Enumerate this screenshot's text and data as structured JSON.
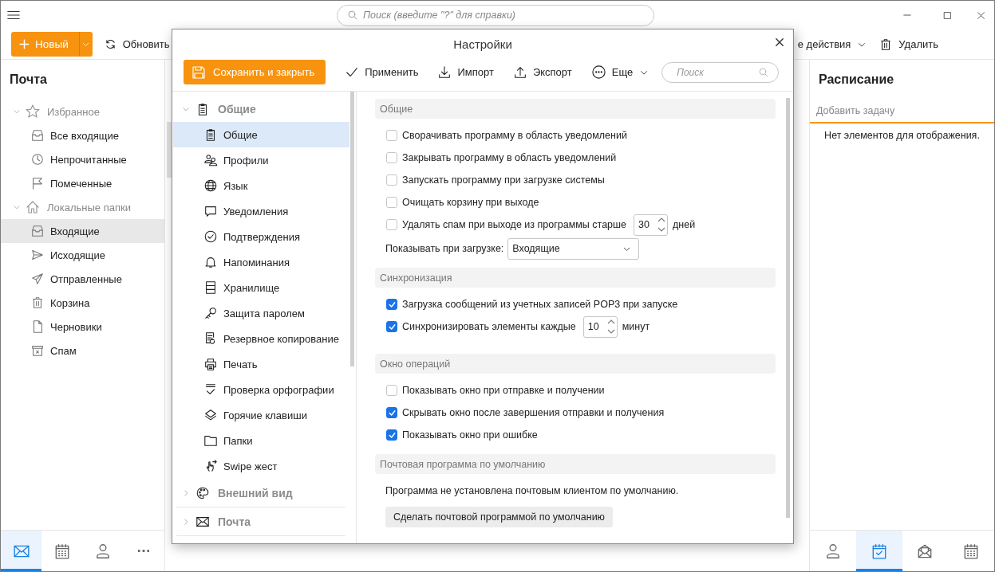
{
  "top_search": {
    "placeholder": "Поиск (введите \"?\" для справки)"
  },
  "toolbar": {
    "new_button": "Новый",
    "refresh": "Обновить",
    "more_actions": "е действия",
    "delete": "Удалить"
  },
  "sidebar": {
    "title": "Почта",
    "groups": [
      {
        "label": "Избранное",
        "expanded": true,
        "items": [
          {
            "label": "Все входящие",
            "selected": false
          },
          {
            "label": "Непрочитанные",
            "selected": false
          },
          {
            "label": "Помеченные",
            "selected": false
          }
        ]
      },
      {
        "label": "Локальные папки",
        "expanded": true,
        "items": [
          {
            "label": "Входящие",
            "selected": true
          },
          {
            "label": "Исходящие",
            "selected": false
          },
          {
            "label": "Отправленные",
            "selected": false
          },
          {
            "label": "Корзина",
            "selected": false
          },
          {
            "label": "Черновики",
            "selected": false
          },
          {
            "label": "Спам",
            "selected": false
          }
        ]
      }
    ]
  },
  "left_nav": [
    {
      "selected": true
    },
    {
      "selected": false
    },
    {
      "selected": false
    },
    {
      "selected": false
    }
  ],
  "schedule": {
    "title": "Расписание",
    "task_placeholder": "Добавить задачу",
    "empty_text": "Нет элементов для отображения."
  },
  "right_nav": [
    {
      "selected": false
    },
    {
      "selected": true
    },
    {
      "selected": false
    },
    {
      "selected": false
    }
  ],
  "dialog": {
    "title": "Настройки",
    "toolbar": {
      "save": "Сохранить и закрыть",
      "apply": "Применить",
      "import": "Импорт",
      "export": "Экспорт",
      "more": "Еще",
      "search_placeholder": "Поиск"
    },
    "nav": [
      {
        "label": "Общие",
        "expanded": true,
        "children": [
          {
            "label": "Общие",
            "selected": true
          },
          {
            "label": "Профили",
            "selected": false
          },
          {
            "label": "Язык",
            "selected": false
          },
          {
            "label": "Уведомления",
            "selected": false
          },
          {
            "label": "Подтверждения",
            "selected": false
          },
          {
            "label": "Напоминания",
            "selected": false
          },
          {
            "label": "Хранилище",
            "selected": false
          },
          {
            "label": "Защита паролем",
            "selected": false
          },
          {
            "label": "Резервное копирование",
            "selected": false
          },
          {
            "label": "Печать",
            "selected": false
          },
          {
            "label": "Проверка орфографии",
            "selected": false
          },
          {
            "label": "Горячие клавиши",
            "selected": false
          },
          {
            "label": "Папки",
            "selected": false
          },
          {
            "label": "Swipe жест",
            "selected": false
          }
        ]
      },
      {
        "label": "Внешний вид",
        "expanded": false
      },
      {
        "label": "Почта",
        "expanded": false
      }
    ],
    "sections": [
      {
        "title": "Общие",
        "items": [
          {
            "kind": "checkbox",
            "label": "Сворачивать программу в область уведомлений",
            "checked": false
          },
          {
            "kind": "checkbox",
            "label": "Закрывать программу в область уведомлений",
            "checked": false
          },
          {
            "kind": "checkbox",
            "label": "Запускать программу при загрузке системы",
            "checked": false
          },
          {
            "kind": "checkbox",
            "label": "Очищать корзину при выходе",
            "checked": false
          },
          {
            "kind": "checkbox_spinner",
            "label": "Удалять спам при выходе из программы старше",
            "checked": false,
            "value": "30",
            "unit": "дней"
          },
          {
            "kind": "select",
            "label": "Показывать при загрузке:",
            "value": "Входящие"
          }
        ]
      },
      {
        "title": "Синхронизация",
        "items": [
          {
            "kind": "checkbox",
            "label": "Загрузка сообщений из учетных записей POP3 при запуске",
            "checked": true
          },
          {
            "kind": "checkbox_spinner",
            "label": "Синхронизировать элементы каждые",
            "checked": true,
            "value": "10",
            "unit": "минут"
          }
        ]
      },
      {
        "title": "Окно операций",
        "items": [
          {
            "kind": "checkbox",
            "label": "Показывать окно при отправке и получении",
            "checked": false
          },
          {
            "kind": "checkbox",
            "label": "Скрывать окно после завершения отправки и получения",
            "checked": true
          },
          {
            "kind": "checkbox",
            "label": "Показывать окно при ошибке",
            "checked": true
          }
        ]
      },
      {
        "title": "Почтовая программа по умолчанию",
        "items": [
          {
            "kind": "text",
            "label": "Программа не установлена почтовым клиентом по умолчанию."
          },
          {
            "kind": "button",
            "label": "Сделать почтовой программой по умолчанию"
          }
        ]
      }
    ]
  }
}
